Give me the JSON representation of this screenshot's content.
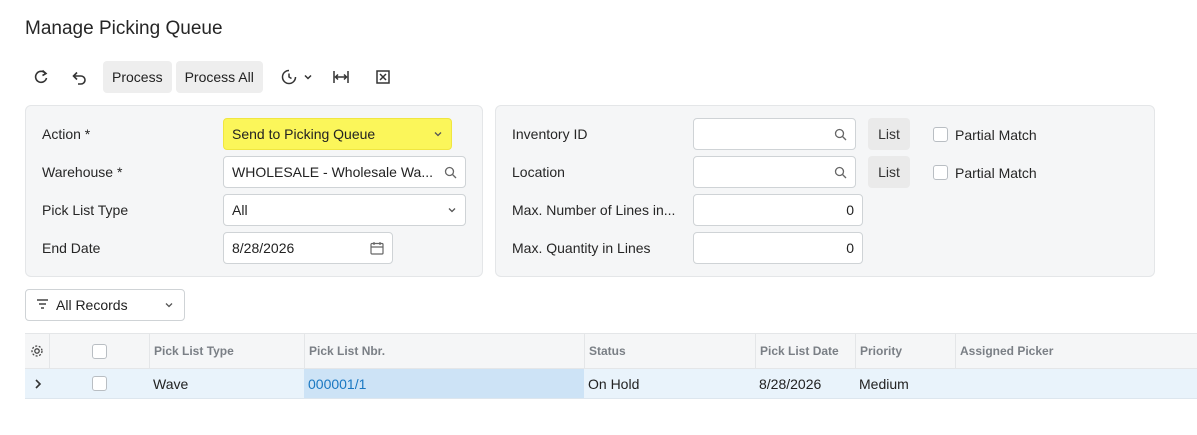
{
  "page": {
    "title": "Manage Picking Queue"
  },
  "toolbar": {
    "refresh_icon": "refresh-icon",
    "undo_icon": "undo-icon",
    "process_label": "Process",
    "process_all_label": "Process All",
    "schedule_icon": "schedule-icon",
    "fit_columns_icon": "fit-columns-icon",
    "export_excel_icon": "excel-export-icon"
  },
  "form": {
    "action": {
      "label": "Action *",
      "value": "Send to Picking Queue"
    },
    "warehouse": {
      "label": "Warehouse *",
      "value": "WHOLESALE - Wholesale Wa..."
    },
    "pick_list_type": {
      "label": "Pick List Type",
      "value": "All"
    },
    "end_date": {
      "label": "End Date",
      "value": "8/28/2026"
    },
    "inventory_id": {
      "label": "Inventory ID",
      "value": "",
      "list_label": "List",
      "partial_label": "Partial Match"
    },
    "location": {
      "label": "Location",
      "value": "",
      "list_label": "List",
      "partial_label": "Partial Match"
    },
    "max_lines": {
      "label": "Max. Number of Lines in...",
      "value": "0"
    },
    "max_qty": {
      "label": "Max. Quantity in Lines",
      "value": "0"
    }
  },
  "filter": {
    "label": "All Records"
  },
  "grid": {
    "columns": [
      "Pick List Type",
      "Pick List Nbr.",
      "Status",
      "Pick List Date",
      "Priority",
      "Assigned Picker"
    ],
    "rows": [
      {
        "pick_list_type": "Wave",
        "pick_list_nbr": "000001/1",
        "status": "On Hold",
        "pick_list_date": "8/28/2026",
        "priority": "Medium",
        "assigned_picker": ""
      }
    ]
  },
  "colors": {
    "highlight": "#fbf65a",
    "link": "#1a78c2",
    "row_selected": "#cde3f6"
  }
}
